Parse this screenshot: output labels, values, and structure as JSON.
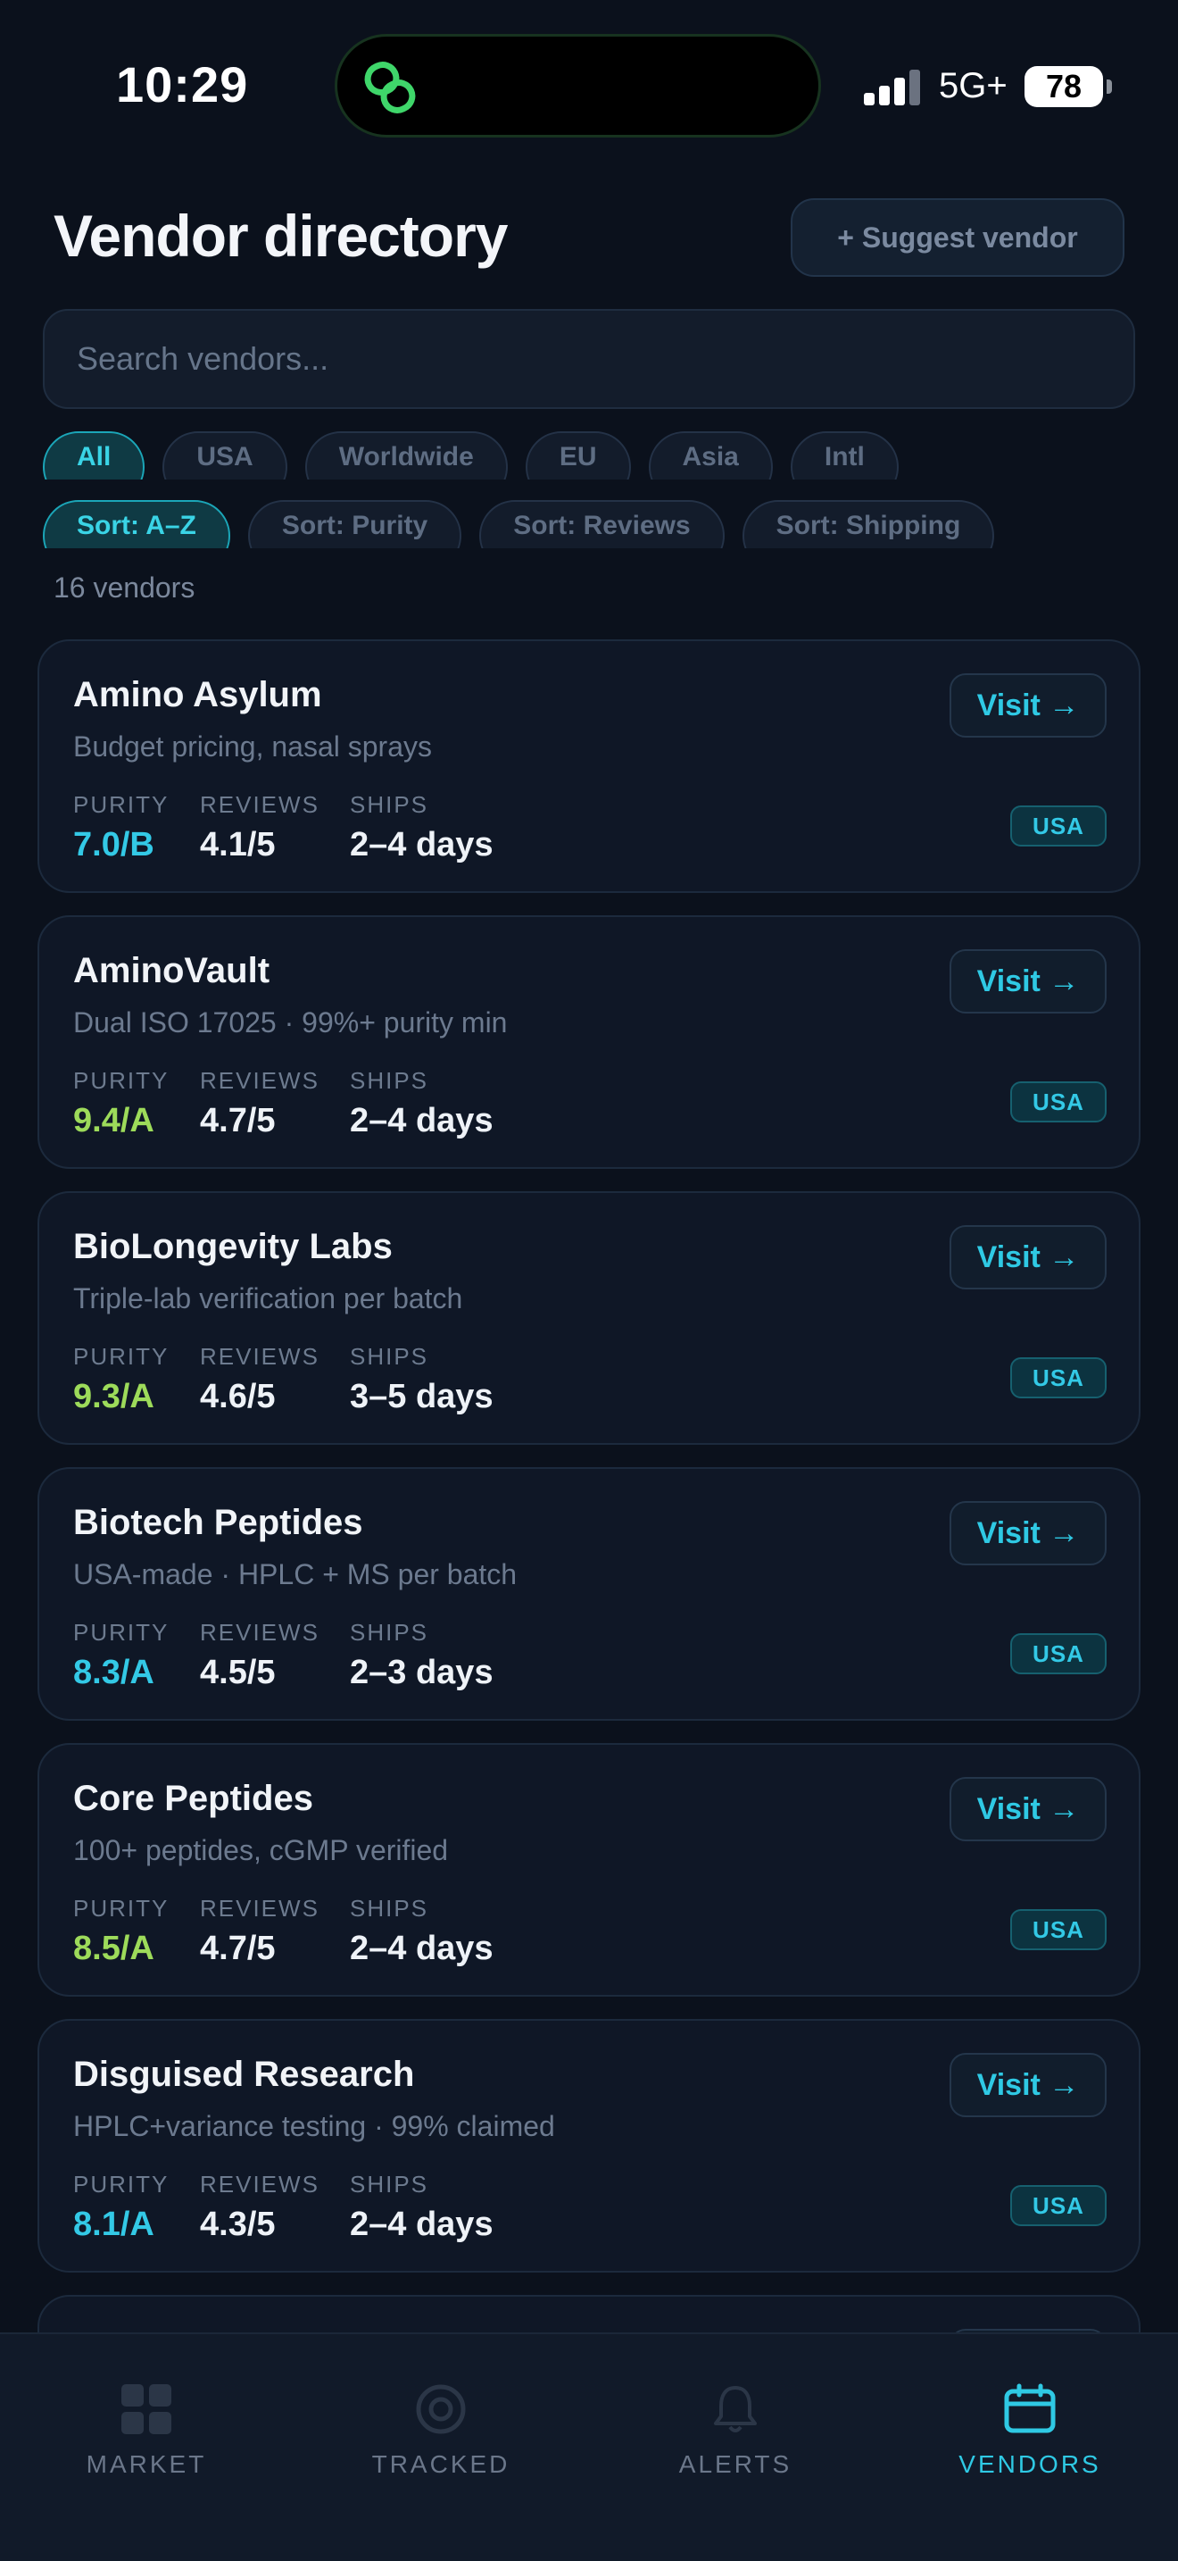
{
  "status_bar": {
    "time": "10:29",
    "network": "5G+",
    "battery": "78"
  },
  "header": {
    "title": "Vendor directory",
    "suggest_label": "+ Suggest vendor"
  },
  "search": {
    "placeholder": "Search vendors...",
    "value": ""
  },
  "region_filters": [
    {
      "label": "All",
      "active": true
    },
    {
      "label": "USA",
      "active": false
    },
    {
      "label": "Worldwide",
      "active": false
    },
    {
      "label": "EU",
      "active": false
    },
    {
      "label": "Asia",
      "active": false
    },
    {
      "label": "Intl",
      "active": false
    }
  ],
  "sort_options": [
    {
      "label": "Sort: A–Z",
      "active": true
    },
    {
      "label": "Sort: Purity",
      "active": false
    },
    {
      "label": "Sort: Reviews",
      "active": false
    },
    {
      "label": "Sort: Shipping",
      "active": false
    }
  ],
  "vendor_count": "16 vendors",
  "stat_labels": {
    "purity": "PURITY",
    "reviews": "REVIEWS",
    "ships": "SHIPS"
  },
  "visit_label": "Visit →",
  "vendors": [
    {
      "name": "Amino Asylum",
      "desc": "Budget pricing, nasal sprays",
      "purity": "7.0/B",
      "grade": "b",
      "reviews": "4.1/5",
      "ships": "2–4 days",
      "region": "USA"
    },
    {
      "name": "AminoVault",
      "desc": "Dual ISO 17025 · 99%+ purity min",
      "purity": "9.4/A",
      "grade": "a",
      "reviews": "4.7/5",
      "ships": "2–4 days",
      "region": "USA"
    },
    {
      "name": "BioLongevity Labs",
      "desc": "Triple-lab verification per batch",
      "purity": "9.3/A",
      "grade": "a",
      "reviews": "4.6/5",
      "ships": "3–5 days",
      "region": "USA"
    },
    {
      "name": "Biotech Peptides",
      "desc": "USA-made · HPLC + MS per batch",
      "purity": "8.3/A",
      "grade": "c",
      "reviews": "4.5/5",
      "ships": "2–3 days",
      "region": "USA"
    },
    {
      "name": "Core Peptides",
      "desc": "100+ peptides, cGMP verified",
      "purity": "8.5/A",
      "grade": "a",
      "reviews": "4.7/5",
      "ships": "2–4 days",
      "region": "USA"
    },
    {
      "name": "Disguised Research",
      "desc": "HPLC+variance testing · 99% claimed",
      "purity": "8.1/A",
      "grade": "c",
      "reviews": "4.3/5",
      "ships": "2–4 days",
      "region": "USA"
    },
    {
      "name": "",
      "desc": "",
      "purity": "",
      "grade": "c",
      "reviews": "",
      "ships": "",
      "region": ""
    }
  ],
  "tabs": [
    {
      "label": "MARKET",
      "icon": "grid-icon",
      "active": false
    },
    {
      "label": "TRACKED",
      "icon": "target-icon",
      "active": false
    },
    {
      "label": "ALERTS",
      "icon": "bell-icon",
      "active": false
    },
    {
      "label": "VENDORS",
      "icon": "calendar-icon",
      "active": true
    }
  ],
  "colors": {
    "accent": "#2fc9e4",
    "grade_a": "#9ddb5a",
    "background": "#0b111c",
    "card": "#0f1726"
  }
}
